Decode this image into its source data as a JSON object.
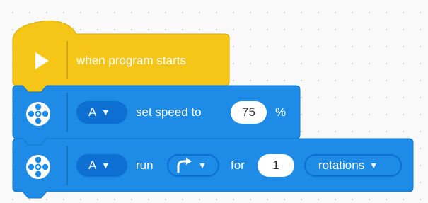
{
  "hat_block": {
    "label": "when program starts",
    "icon": "play-icon",
    "color": "#f5c518"
  },
  "speed_block": {
    "port": "A",
    "label": "set speed to",
    "value": "75",
    "unit": "%",
    "icon": "motor-icon",
    "color": "#1e8be6"
  },
  "run_block": {
    "port": "A",
    "label": "run",
    "direction_icon": "clockwise-arrow-icon",
    "for_label": "for",
    "value": "1",
    "unit_option": "rotations",
    "icon": "motor-icon",
    "color": "#1e8be6"
  }
}
